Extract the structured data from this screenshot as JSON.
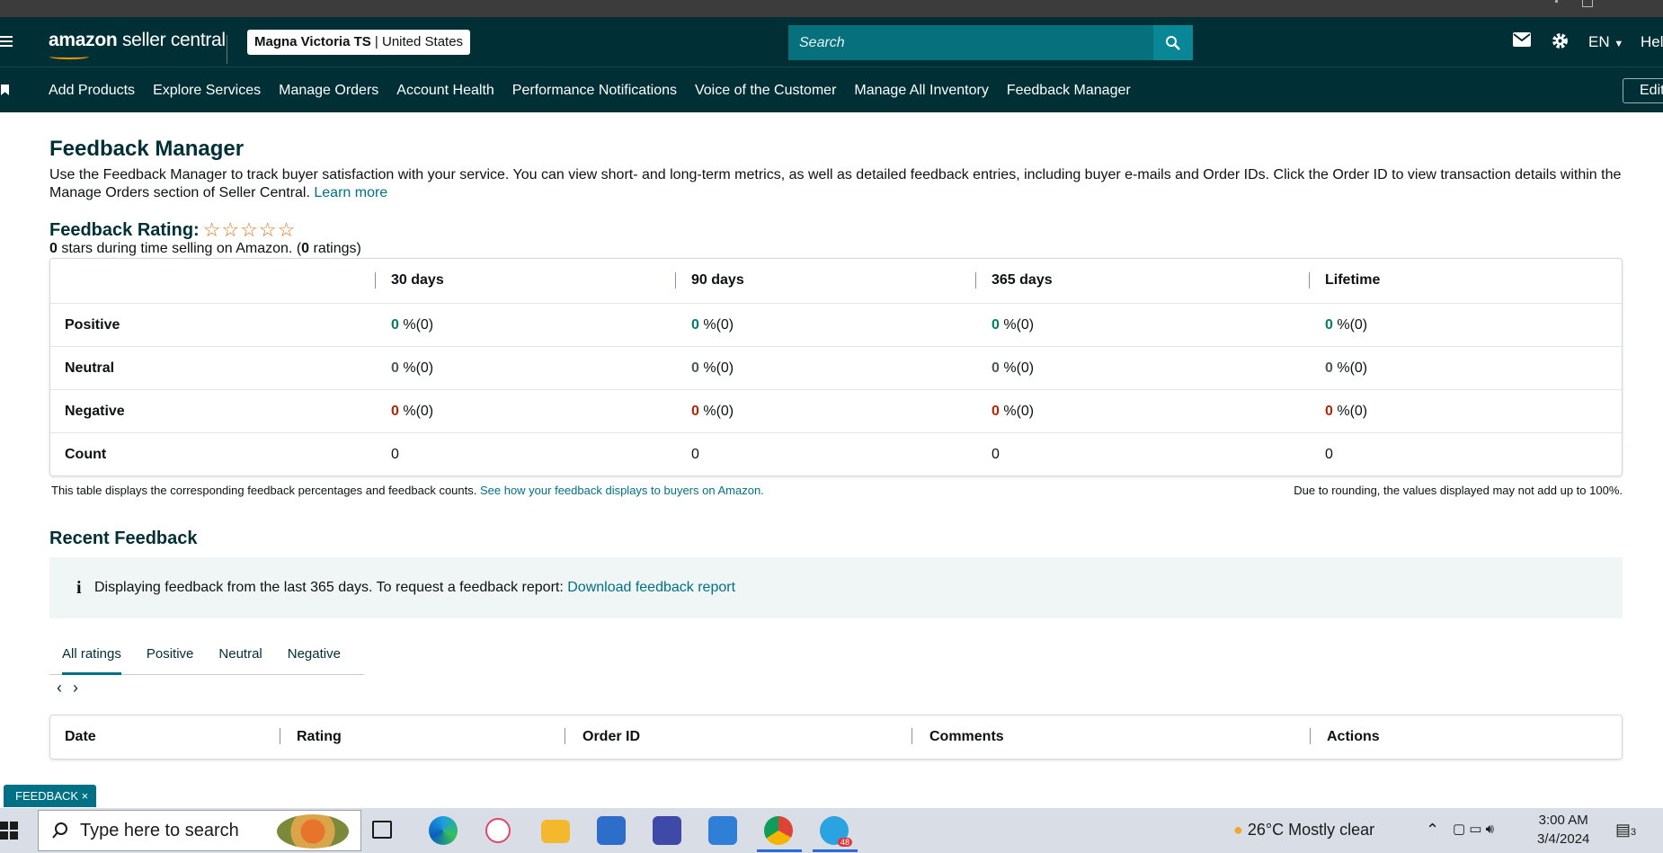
{
  "header": {
    "logo_main": "amazon",
    "logo_sub": "seller central",
    "account_name": "Magna Victoria TS",
    "account_region": "United States",
    "search_placeholder": "Search",
    "language": "EN",
    "help": "Hel",
    "icons": [
      "menu-icon",
      "search-icon",
      "mail-icon",
      "gear-icon",
      "chevron-down-icon"
    ]
  },
  "subnav": {
    "items": [
      "Add Products",
      "Explore Services",
      "Manage Orders",
      "Account Health",
      "Performance Notifications",
      "Voice of the Customer",
      "Manage All Inventory",
      "Feedback Manager"
    ],
    "edit": "Edit"
  },
  "page": {
    "title": "Feedback Manager",
    "intro": "Use the Feedback Manager to track buyer satisfaction with your service. You can view short- and long-term metrics, as well as detailed feedback entries, including buyer e-mails and Order IDs. Click the Order ID to view transaction details within the Manage Orders section of Seller Central.",
    "learn_more": "Learn more",
    "rating_title": "Feedback Rating:",
    "stars": 0,
    "stars_text": "☆☆☆☆☆",
    "rating_sub_pre": "0",
    "rating_sub_mid": " stars during time selling on Amazon. (",
    "rating_sub_count": "0",
    "rating_sub_post": " ratings)"
  },
  "feedback_table": {
    "columns": [
      "30 days",
      "90 days",
      "365 days",
      "Lifetime"
    ],
    "rows": [
      {
        "label": "Positive",
        "values": [
          "0",
          "0",
          "0",
          "0"
        ],
        "suffix": " %(0)"
      },
      {
        "label": "Neutral",
        "values": [
          "0",
          "0",
          "0",
          "0"
        ],
        "suffix": " %(0)"
      },
      {
        "label": "Negative",
        "values": [
          "0",
          "0",
          "0",
          "0"
        ],
        "suffix": " %(0)"
      },
      {
        "label": "Count",
        "values": [
          "0",
          "0",
          "0",
          "0"
        ],
        "suffix": ""
      }
    ],
    "note": "This table displays the corresponding feedback percentages and feedback counts.",
    "note_link": "See how your feedback displays to buyers on Amazon.",
    "rounding_note": "Due to rounding, the values displayed may not add up to 100%."
  },
  "recent": {
    "title": "Recent Feedback",
    "info_text": "Displaying feedback from the last 365 days. To request a feedback report:",
    "info_link": "Download feedback report",
    "tabs": [
      "All ratings",
      "Positive",
      "Neutral",
      "Negative"
    ],
    "active_tab": "All ratings",
    "columns": [
      "Date",
      "Rating",
      "Order ID",
      "Comments",
      "Actions"
    ]
  },
  "feedback_tab": "FEEDBACK ×",
  "taskbar": {
    "search_placeholder": "Type here to search",
    "weather": "26°C  Mostly clear",
    "time": "3:00 AM",
    "date": "3/4/2024",
    "telegram_badge": "48",
    "notification_count": "3"
  }
}
